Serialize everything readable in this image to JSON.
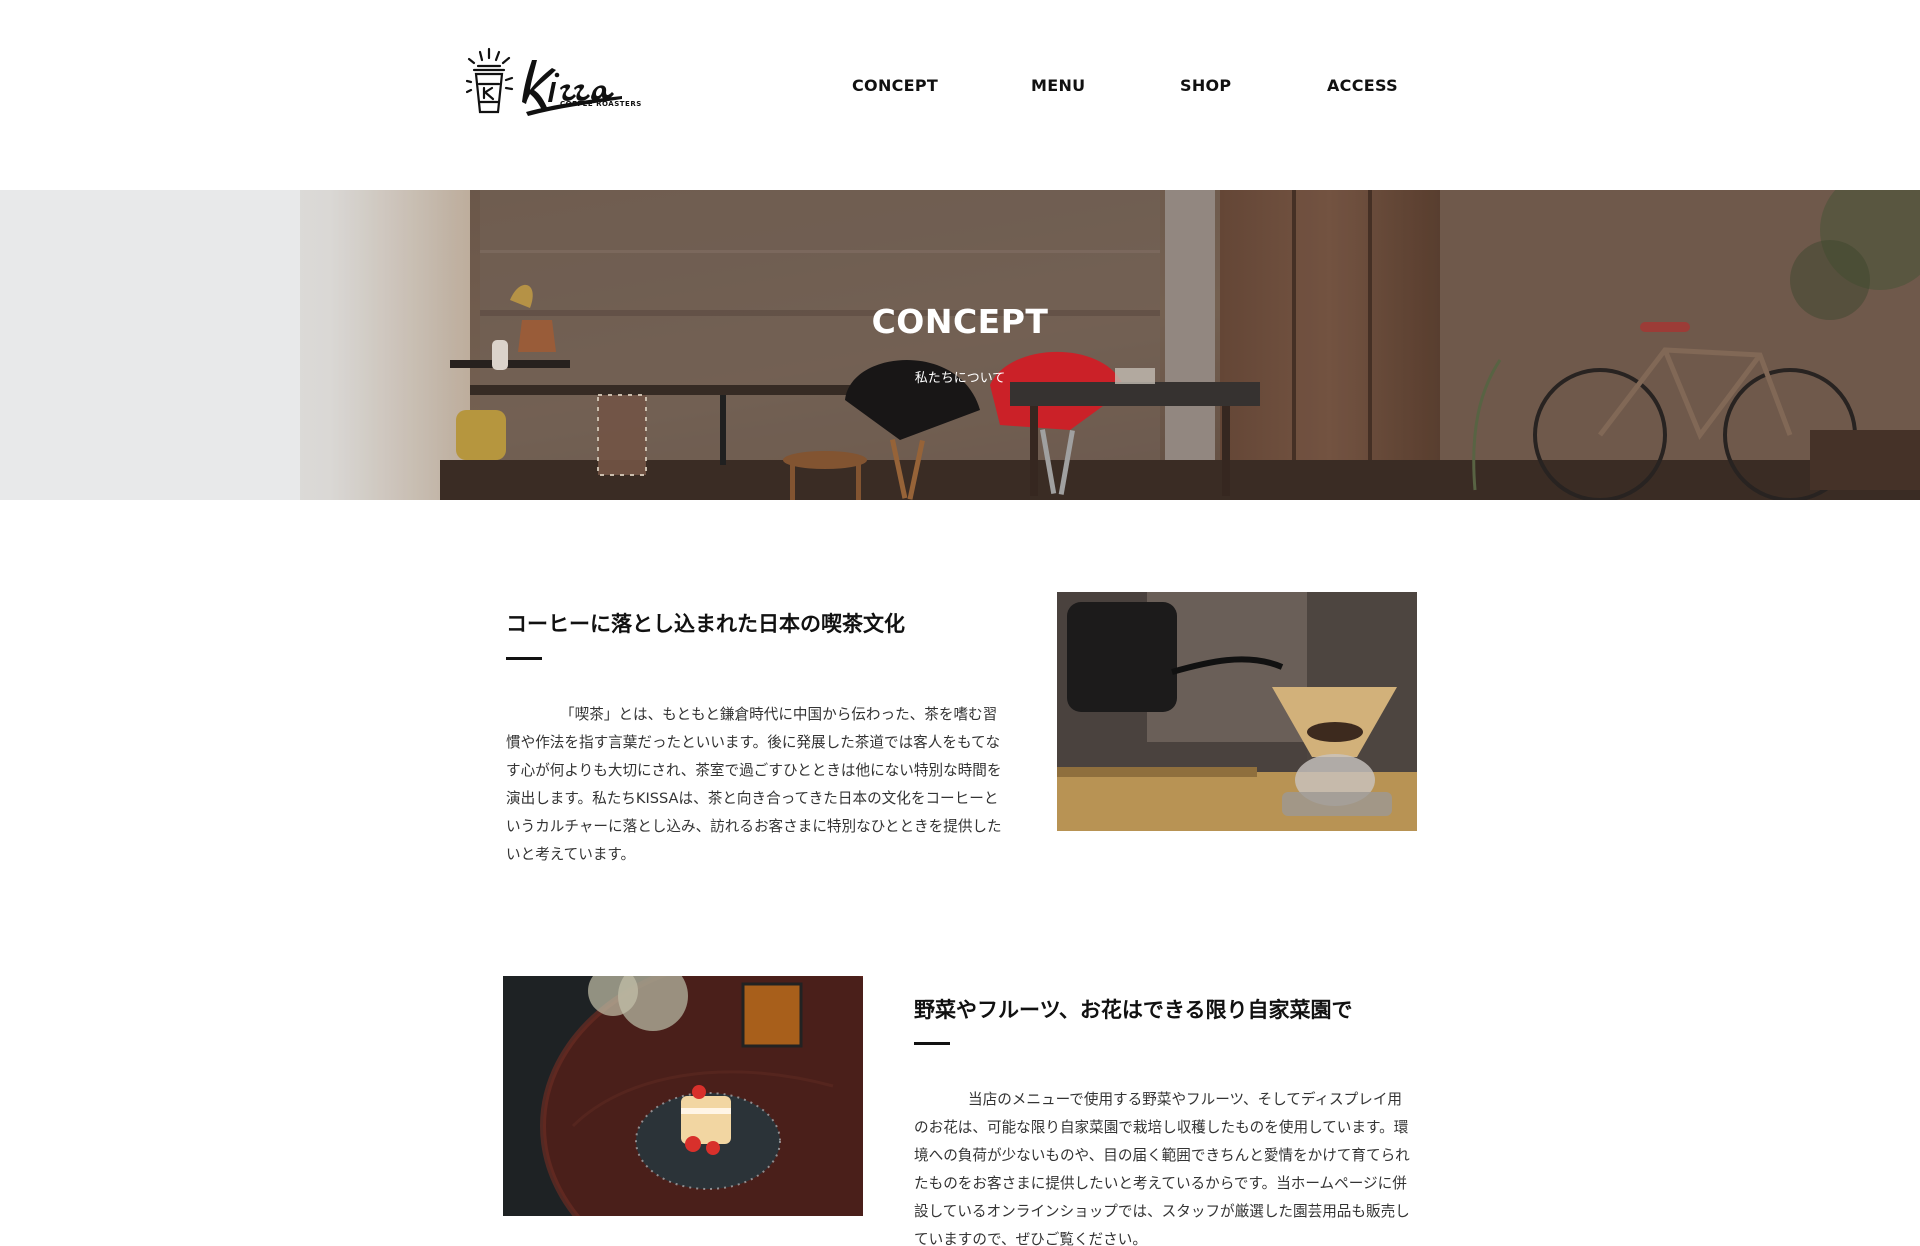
{
  "brand": {
    "name": "Kissa",
    "tagline": "COFFEE ROASTERS"
  },
  "nav": {
    "items": [
      {
        "label": "CONCEPT"
      },
      {
        "label": "MENU"
      },
      {
        "label": "SHOP"
      },
      {
        "label": "ACCESS"
      }
    ]
  },
  "hero": {
    "title": "CONCEPT",
    "subtitle": "私たちについて"
  },
  "sections": [
    {
      "title": "コーヒーに落とし込まれた日本の喫茶文化",
      "body": "「喫茶」とは、もともと鎌倉時代に中国から伝わった、茶を嗜む習慣や作法を指す言葉だったといいます。後に発展した茶道では客人をもてなす心が何よりも大切にされ、茶室で過ごすひとときは他にない特別な時間を演出します。私たちKISSAは、茶と向き合ってきた日本の文化をコーヒーというカルチャーに落とし込み、訪れるお客さまに特別なひとときを提供したいと考えています。",
      "image": "pour-over-coffee-photo"
    },
    {
      "title": "野菜やフルーツ、お花はできる限り自家菜園で",
      "body": "当店のメニューで使用する野菜やフルーツ、そしてディスプレイ用のお花は、可能な限り自家菜園で栽培し収穫したものを使用しています。環境への負荷が少ないものや、目の届く範囲できちんと愛情をかけて育てられたものをお客さまに提供したいと考えているからです。当ホームページに併設しているオンラインショップでは、スタッフが厳選した園芸用品も販売していますので、ぜひご覧ください。",
      "image": "strawberry-cake-photo"
    }
  ],
  "colors": {
    "text": "#111111",
    "chair_red": "#d8242b"
  }
}
